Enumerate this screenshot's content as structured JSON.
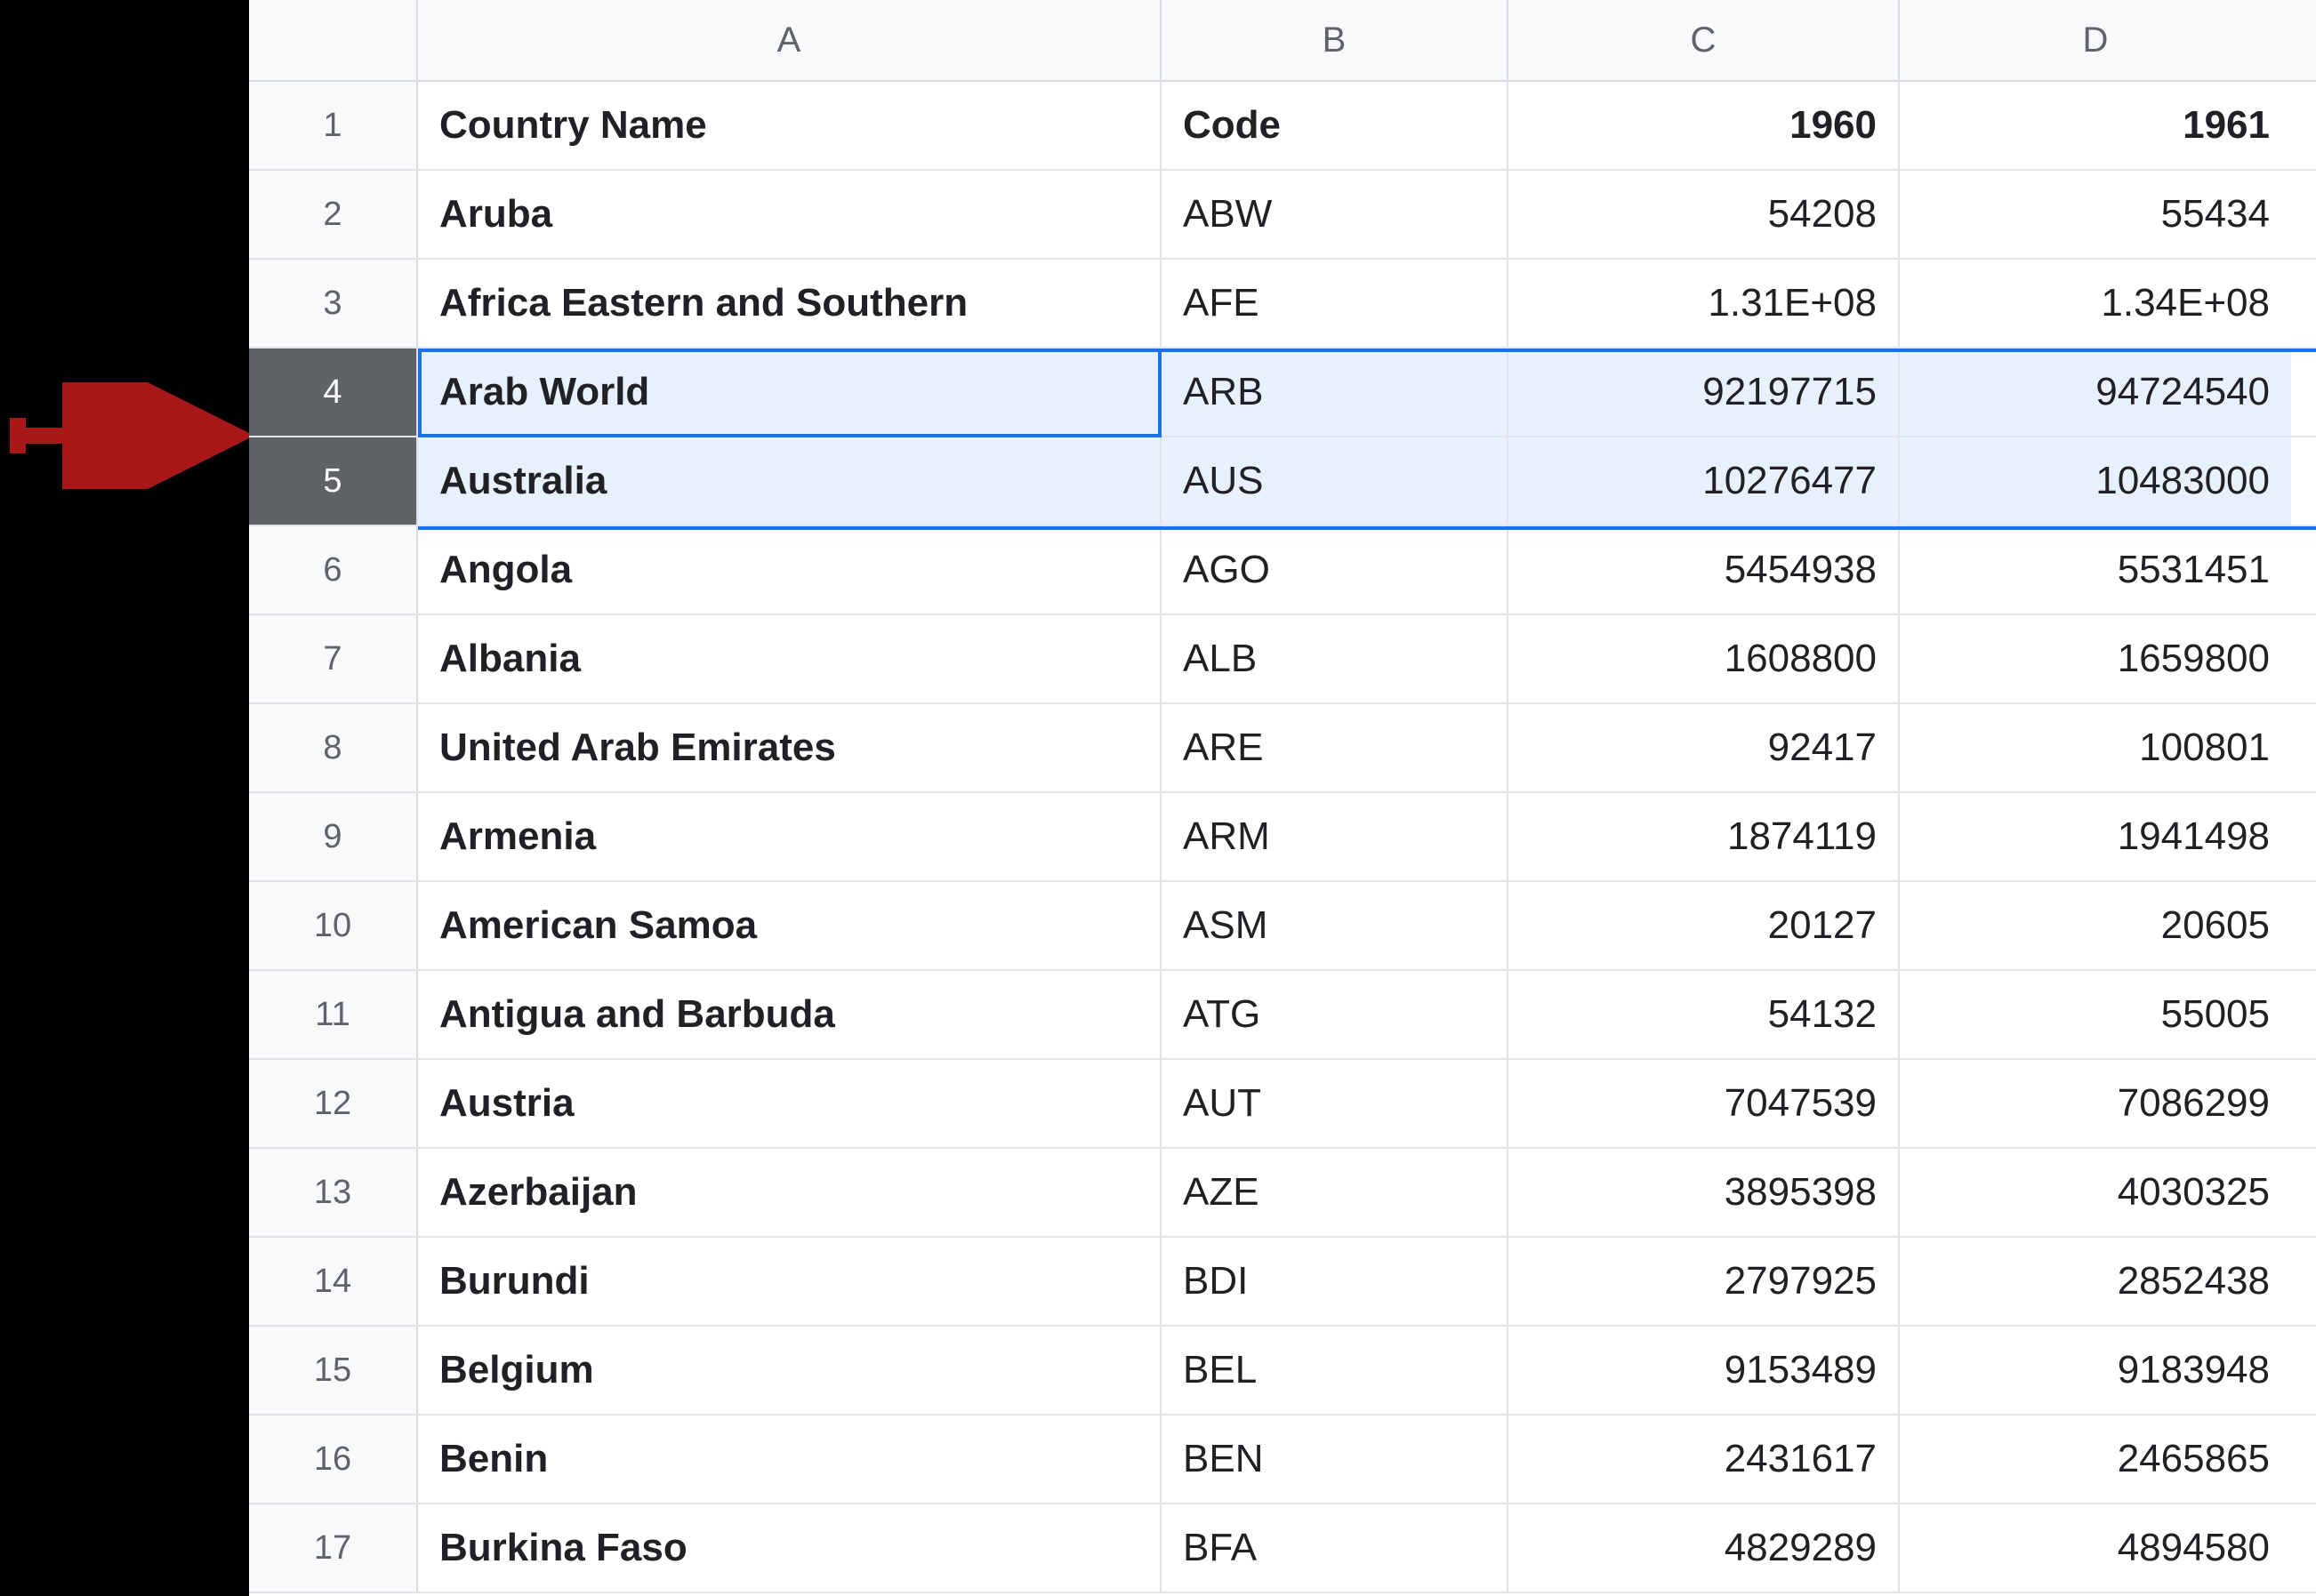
{
  "columns": [
    "A",
    "B",
    "C",
    "D"
  ],
  "annotation": {
    "type": "arrow",
    "color": "#A81818",
    "points_to_row": 4
  },
  "selection": {
    "rows": [
      4,
      5
    ],
    "active_cell": "A4"
  },
  "header_row": {
    "country": "Country Name",
    "code": "Code",
    "y1960": "1960",
    "y1961": "1961"
  },
  "rows": [
    {
      "n": 1,
      "is_header": true
    },
    {
      "n": 2,
      "country": "Aruba",
      "code": "ABW",
      "y1960": "54208",
      "y1961": "55434"
    },
    {
      "n": 3,
      "country": "Africa Eastern and Southern",
      "code": "AFE",
      "y1960": "1.31E+08",
      "y1961": "1.34E+08"
    },
    {
      "n": 4,
      "country": "Arab World",
      "code": "ARB",
      "y1960": "92197715",
      "y1961": "94724540"
    },
    {
      "n": 5,
      "country": "Australia",
      "code": "AUS",
      "y1960": "10276477",
      "y1961": "10483000"
    },
    {
      "n": 6,
      "country": "Angola",
      "code": "AGO",
      "y1960": "5454938",
      "y1961": "5531451"
    },
    {
      "n": 7,
      "country": "Albania",
      "code": "ALB",
      "y1960": "1608800",
      "y1961": "1659800"
    },
    {
      "n": 8,
      "country": "United Arab Emirates",
      "code": "ARE",
      "y1960": "92417",
      "y1961": "100801"
    },
    {
      "n": 9,
      "country": "Armenia",
      "code": "ARM",
      "y1960": "1874119",
      "y1961": "1941498"
    },
    {
      "n": 10,
      "country": "American Samoa",
      "code": "ASM",
      "y1960": "20127",
      "y1961": "20605"
    },
    {
      "n": 11,
      "country": "Antigua and Barbuda",
      "code": "ATG",
      "y1960": "54132",
      "y1961": "55005"
    },
    {
      "n": 12,
      "country": "Austria",
      "code": "AUT",
      "y1960": "7047539",
      "y1961": "7086299"
    },
    {
      "n": 13,
      "country": "Azerbaijan",
      "code": "AZE",
      "y1960": "3895398",
      "y1961": "4030325"
    },
    {
      "n": 14,
      "country": "Burundi",
      "code": "BDI",
      "y1960": "2797925",
      "y1961": "2852438"
    },
    {
      "n": 15,
      "country": "Belgium",
      "code": "BEL",
      "y1960": "9153489",
      "y1961": "9183948"
    },
    {
      "n": 16,
      "country": "Benin",
      "code": "BEN",
      "y1960": "2431617",
      "y1961": "2465865"
    },
    {
      "n": 17,
      "country": "Burkina Faso",
      "code": "BFA",
      "y1960": "4829289",
      "y1961": "4894580"
    }
  ]
}
